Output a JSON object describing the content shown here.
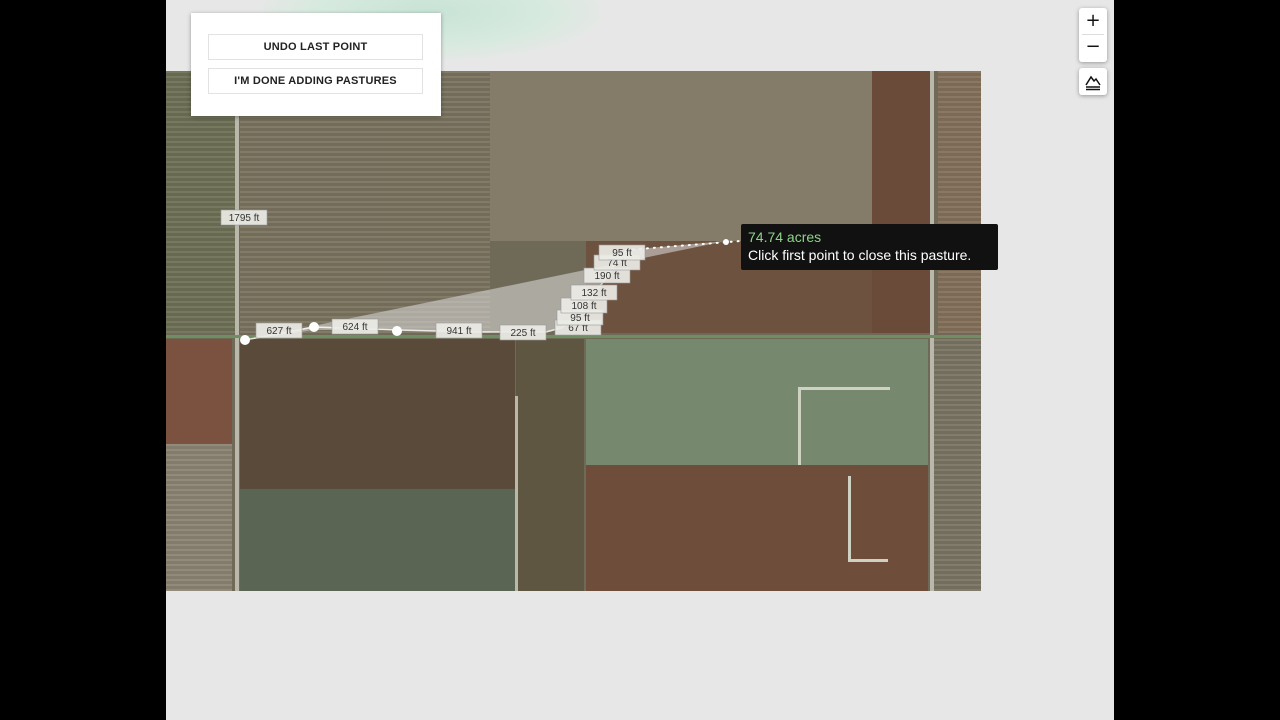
{
  "controls": {
    "undo_label": "UNDO LAST POINT",
    "done_label": "I'M DONE ADDING PASTURES"
  },
  "tooltip": {
    "acres": "74.74 acres",
    "hint": "Click first point to close this pasture."
  },
  "map_controls": {
    "zoom_in": "+",
    "zoom_out": "−",
    "terrain_icon": "terrain-icon"
  },
  "segment_labels": {
    "north_side": "1795 ft",
    "seg_1": "627 ft",
    "seg_2": "624 ft",
    "seg_3": "941 ft",
    "seg_4": "225 ft",
    "seg_5": "67 ft",
    "seg_6": "95 ft",
    "seg_7": "108 ft",
    "seg_8": "132 ft",
    "seg_9": "190 ft",
    "seg_10": "74 ft",
    "seg_11": "95 ft"
  },
  "colors": {
    "tooltip_acres": "#8fd28a",
    "polygon_fill": "#d8d8d8"
  }
}
